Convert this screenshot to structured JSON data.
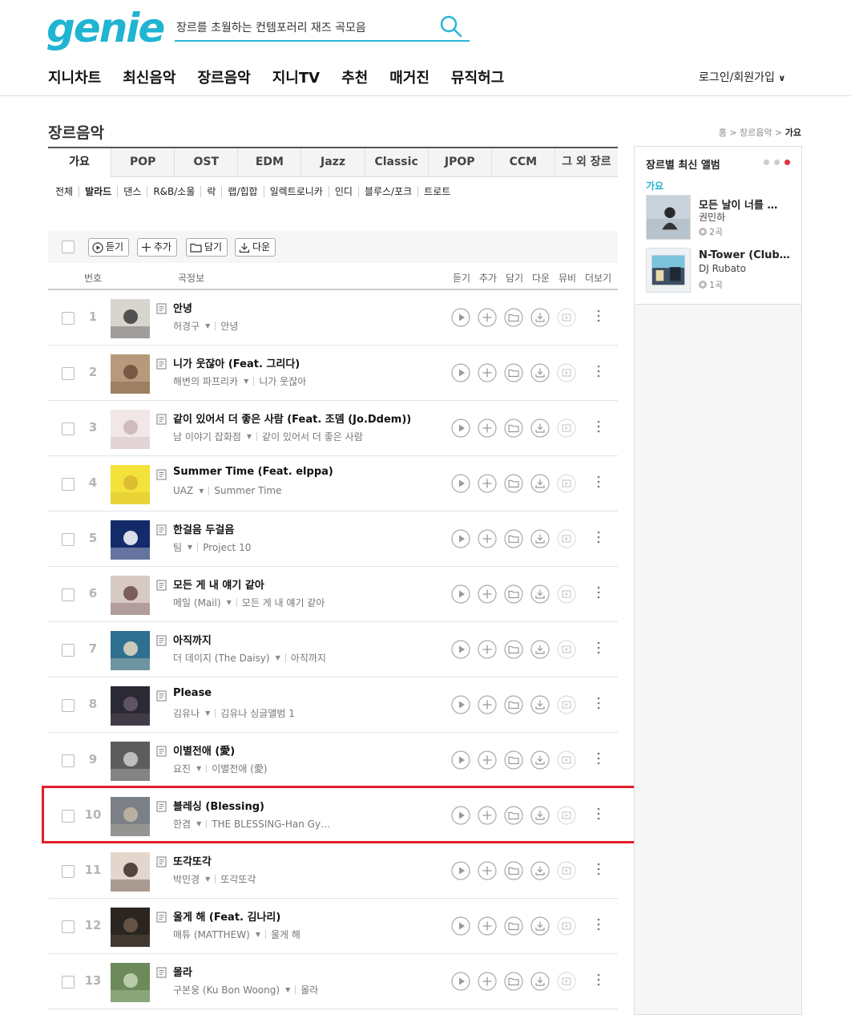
{
  "header": {
    "logo": "genie",
    "search_value": "장르를 초월하는 컨템포러리 재즈 곡모음",
    "nav": [
      "지니차트",
      "최신음악",
      "장르음악",
      "지니TV",
      "추천",
      "매거진",
      "뮤직허그"
    ],
    "login": "로그인/회원가입"
  },
  "page": {
    "title": "장르음악",
    "breadcrumb": [
      "홈",
      "장르음악",
      "가요"
    ]
  },
  "genre_tabs": [
    "가요",
    "POP",
    "OST",
    "EDM",
    "Jazz",
    "Classic",
    "JPOP",
    "CCM",
    "그 외 장르"
  ],
  "active_genre_tab": "가요",
  "sub_genres": [
    "전체",
    "발라드",
    "댄스",
    "R&B/소울",
    "락",
    "랩/힙합",
    "일렉트로니카",
    "인디",
    "블루스/포크",
    "트로트"
  ],
  "active_sub_genre": "발라드",
  "toolbar": {
    "listen": "듣기",
    "add": "추가",
    "save": "담기",
    "download": "다운"
  },
  "columns": {
    "number": "번호",
    "song_info": "곡정보",
    "listen": "듣기",
    "add": "추가",
    "save": "담기",
    "download": "다운",
    "mv": "뮤비",
    "more": "더보기"
  },
  "songs": [
    {
      "rank": "1",
      "title": "안녕",
      "artist": "허경구",
      "album": "안녕"
    },
    {
      "rank": "2",
      "title": "니가 웃잖아 (Feat. 그리다)",
      "artist": "해변의 파프리카",
      "album": "니가 웃잖아"
    },
    {
      "rank": "3",
      "title": "같이 있어서 더 좋은 사람 (Feat. 조뎀 (Jo.Ddem))",
      "artist": "남 이야기 잡화점",
      "album": "같이 있어서 더 좋은 사람"
    },
    {
      "rank": "4",
      "title": "Summer Time (Feat. elppa)",
      "artist": "UAZ",
      "album": "Summer Time"
    },
    {
      "rank": "5",
      "title": "한걸음 두걸음",
      "artist": "팀",
      "album": "Project 10"
    },
    {
      "rank": "6",
      "title": "모든 게 내 얘기 같아",
      "artist": "메일 (Mail)",
      "album": "모든 게 내 얘기 같아"
    },
    {
      "rank": "7",
      "title": "아직까지",
      "artist": "더 데이지 (The Daisy)",
      "album": "아직까지"
    },
    {
      "rank": "8",
      "title": "Please",
      "artist": "김유나",
      "album": "김유나 싱글앨범 1"
    },
    {
      "rank": "9",
      "title": "이별전애 (愛)",
      "artist": "요진",
      "album": "이별전애 (愛)"
    },
    {
      "rank": "10",
      "title": "블레싱 (Blessing)",
      "artist": "한겸",
      "album": "THE BLESSING-Han Gy…"
    },
    {
      "rank": "11",
      "title": "또각또각",
      "artist": "박민경",
      "album": "또각또각"
    },
    {
      "rank": "12",
      "title": "울게 해 (Feat. 김나리)",
      "artist": "매튜 (MATTHEW)",
      "album": "울게 해"
    },
    {
      "rank": "13",
      "title": "몰라",
      "artist": "구본웅 (Ku Bon Woong)",
      "album": "몰라"
    }
  ],
  "highlighted_rank": "10",
  "side_panel": {
    "title": "장르별 최신 앨범",
    "genre": "가요",
    "albums": [
      {
        "title": "모든 날이 너를 …",
        "artist": "권민하",
        "count": "2곡"
      },
      {
        "title": "N-Tower (Club…",
        "artist": "DJ Rubato",
        "count": "1곡"
      }
    ]
  },
  "colors": {
    "brand": "#1fb5d2",
    "highlight": "#e41d27",
    "dot_active": "#e5323b"
  }
}
